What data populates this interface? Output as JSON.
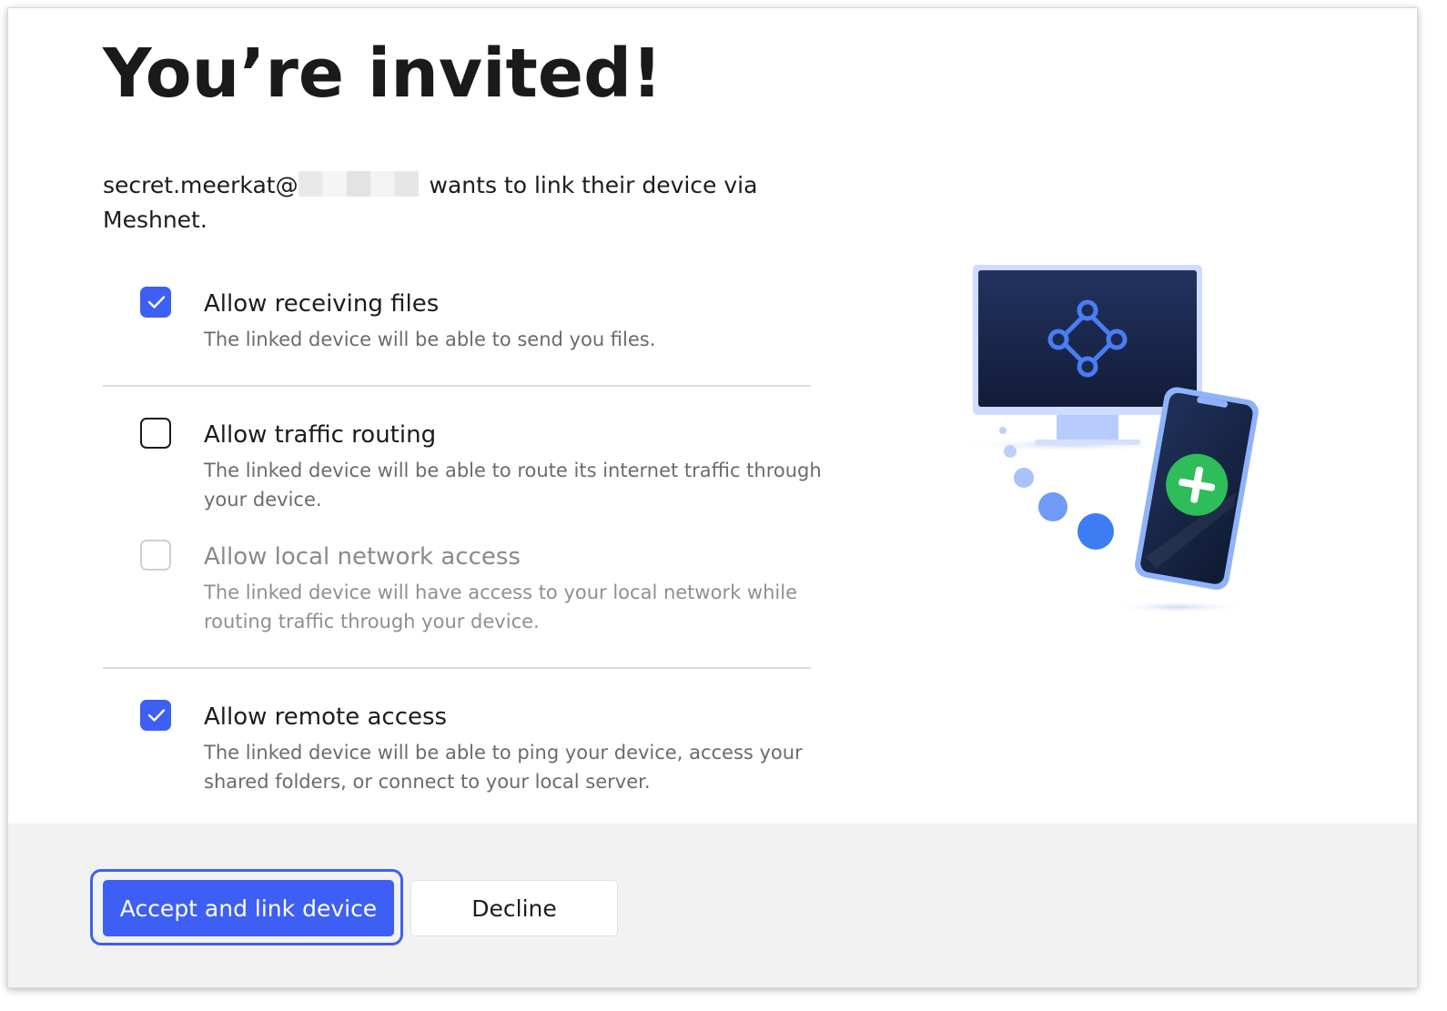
{
  "dialog": {
    "title": "You’re invited!",
    "invite_sender": "secret.meerkat@",
    "invite_message": "wants to link their device via Meshnet."
  },
  "permissions": [
    {
      "label": "Allow receiving files",
      "description": "The linked device will be able to send you files.",
      "state": "checked"
    },
    {
      "label": "Allow traffic routing",
      "description": "The linked device will be able to route its internet traffic through your device.",
      "state": "unchecked"
    },
    {
      "label": "Allow local network access",
      "description": "The linked device will have access to your local network while routing traffic through your device.",
      "state": "disabled"
    },
    {
      "label": "Allow remote access",
      "description": "The linked device will be able to ping your device, access your shared folders, or connect to your local server.",
      "state": "checked"
    }
  ],
  "footer": {
    "accept_label": "Accept and link device",
    "decline_label": "Decline"
  },
  "colors": {
    "accent": "#3e5ff3",
    "plus_green": "#2ebd59",
    "monitor_dark": "#172447"
  },
  "icons": {
    "illustration": "meshnet-device-link-illustration",
    "checkmark": "checkmark-icon"
  }
}
